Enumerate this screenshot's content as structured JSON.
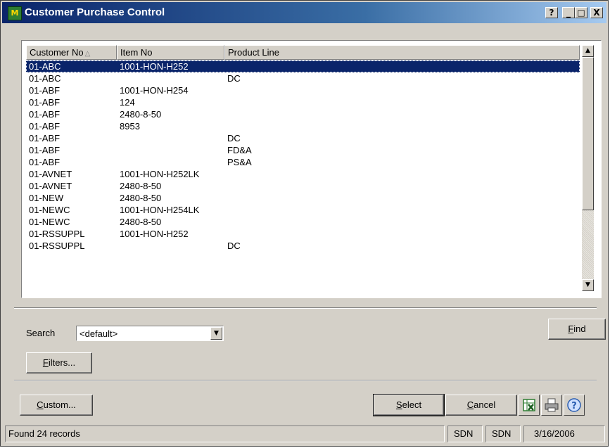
{
  "window": {
    "title": "Customer Purchase Control"
  },
  "titlebar_buttons": {
    "help": "?",
    "minimize": "_",
    "maximize": "□",
    "close": "X"
  },
  "list": {
    "columns": [
      "Customer No",
      "Item No",
      "Product Line"
    ],
    "rows": [
      {
        "customer": "01-ABC",
        "item": "1001-HON-H252",
        "line": "",
        "selected": true
      },
      {
        "customer": "01-ABC",
        "item": "",
        "line": "DC"
      },
      {
        "customer": "01-ABF",
        "item": "1001-HON-H254",
        "line": ""
      },
      {
        "customer": "01-ABF",
        "item": "124",
        "line": ""
      },
      {
        "customer": "01-ABF",
        "item": "2480-8-50",
        "line": ""
      },
      {
        "customer": "01-ABF",
        "item": "8953",
        "line": ""
      },
      {
        "customer": "01-ABF",
        "item": "",
        "line": "DC"
      },
      {
        "customer": "01-ABF",
        "item": "",
        "line": "FD&A"
      },
      {
        "customer": "01-ABF",
        "item": "",
        "line": "PS&A"
      },
      {
        "customer": "01-AVNET",
        "item": "1001-HON-H252LK",
        "line": ""
      },
      {
        "customer": "01-AVNET",
        "item": "2480-8-50",
        "line": ""
      },
      {
        "customer": "01-NEW",
        "item": "2480-8-50",
        "line": ""
      },
      {
        "customer": "01-NEWC",
        "item": "1001-HON-H254LK",
        "line": ""
      },
      {
        "customer": "01-NEWC",
        "item": "2480-8-50",
        "line": ""
      },
      {
        "customer": "01-RSSUPPL",
        "item": "1001-HON-H252",
        "line": ""
      },
      {
        "customer": "01-RSSUPPL",
        "item": "",
        "line": "DC"
      }
    ]
  },
  "search": {
    "label": "Search",
    "value": "<default>"
  },
  "buttons": {
    "find_prefix": "",
    "find_key": "F",
    "find_rest": "ind",
    "filters_prefix": "",
    "filters_key": "F",
    "filters_rest": "ilters...",
    "custom_prefix": "",
    "custom_key": "C",
    "custom_rest": "ustom...",
    "select_prefix": "",
    "select_key": "S",
    "select_rest": "elect",
    "cancel_prefix": "",
    "cancel_key": "C",
    "cancel_rest": "ancel"
  },
  "icons": {
    "excel": "excel-icon",
    "print": "printer-icon",
    "help": "help-icon"
  },
  "status": {
    "records": "Found 24 records",
    "company1": "SDN",
    "company2": "SDN",
    "date": "3/16/2006"
  },
  "colors": {
    "selection": "#0a246a",
    "face": "#d4d0c8",
    "title_start": "#0a246a"
  }
}
